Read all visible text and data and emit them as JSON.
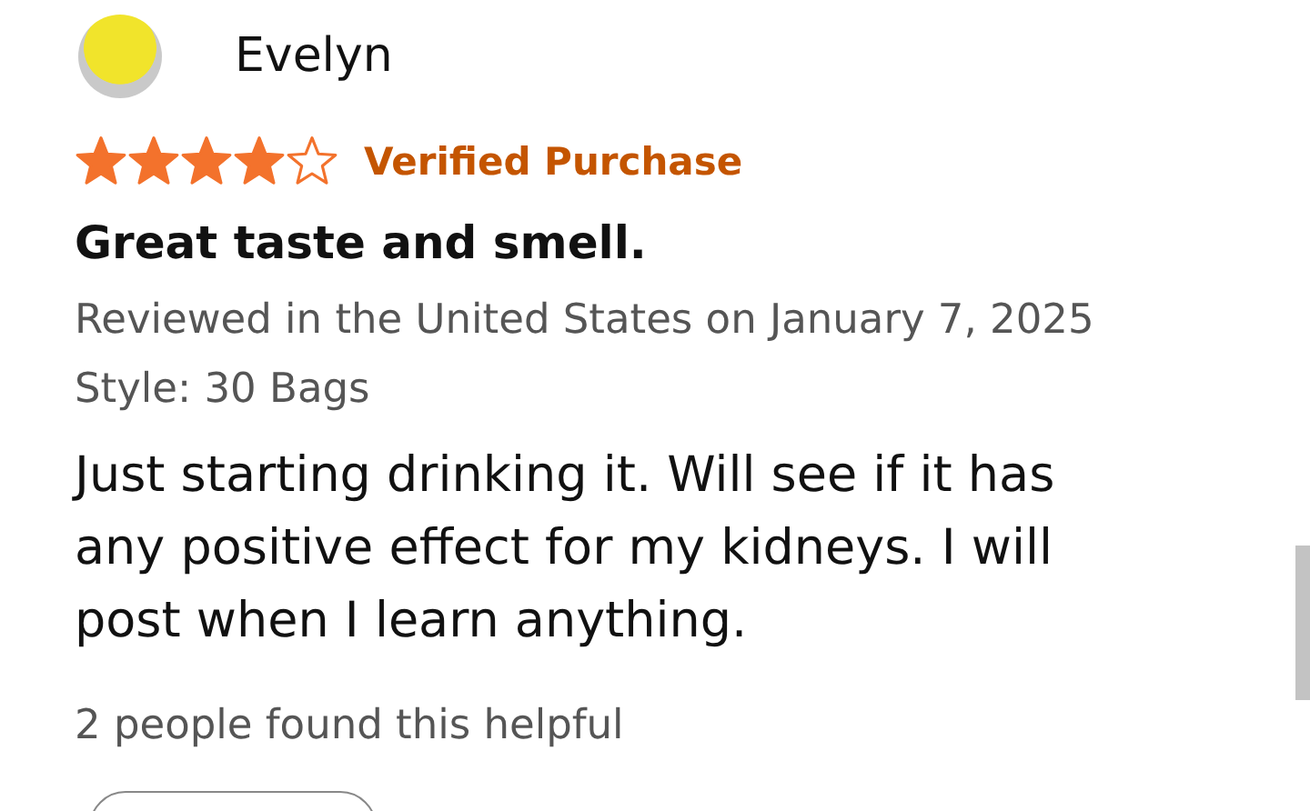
{
  "review": {
    "author": "Evelyn",
    "stars": 4,
    "badge": "Verified Purchase",
    "title": "Great taste and smell.",
    "meta": "Reviewed in the United States on January 7, 2025",
    "style": "Style: 30 Bags",
    "body": "Just starting drinking it. Will see if it has any positive effect for my kidneys. I will post when I learn anything.",
    "helpful": "2 people found this helpful"
  }
}
